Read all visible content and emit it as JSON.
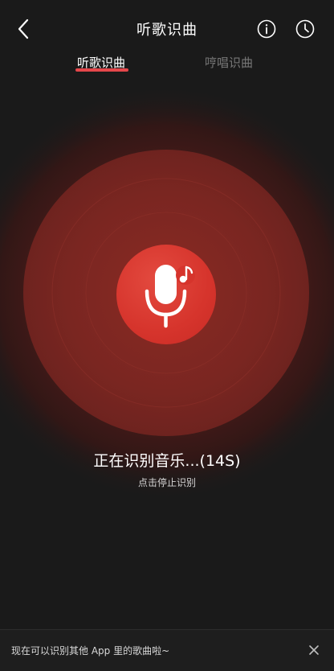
{
  "header": {
    "title": "听歌识曲",
    "back_icon": "chevron-left-icon",
    "info_icon": "info-circle-icon",
    "history_icon": "clock-icon"
  },
  "tabs": [
    {
      "label": "听歌识曲",
      "active": true
    },
    {
      "label": "哼唱识曲",
      "active": false
    }
  ],
  "recognition": {
    "status": "正在识别音乐...(14S)",
    "hint": "点击停止识别",
    "mic_icon": "microphone-music-icon"
  },
  "banner": {
    "text": "现在可以识别其他 App 里的歌曲啦~",
    "close_icon": "close-icon"
  },
  "colors": {
    "background": "#1a1a1a",
    "accent": "#e5474b",
    "button": "#d6342c",
    "inactive_tab": "#777777"
  }
}
